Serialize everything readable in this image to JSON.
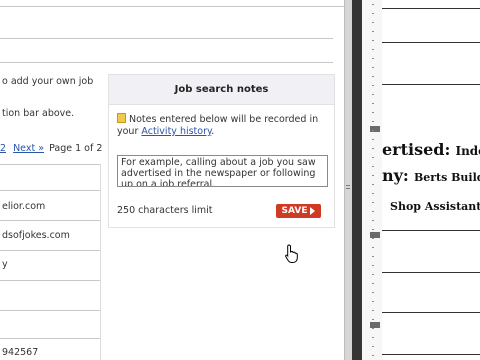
{
  "left_panel": {
    "intro_line1": "o add your own job",
    "intro_line2": "tion bar above.",
    "pager": {
      "page_link": "2",
      "next_label": "Next »",
      "page_info": "Page 1 of 2"
    },
    "rows": [
      "elior.com",
      "dsofjokes.com",
      "y",
      "942567"
    ]
  },
  "notes": {
    "title": "Job search notes",
    "info_text": "Notes entered below will be recorded in your ",
    "activity_link": "Activity history",
    "info_end": ".",
    "textarea_value": "For example, calling about a job you saw advertised in the newspaper or following up on a job referral.",
    "char_limit": "250 characters limit",
    "save_label": "SAVE"
  },
  "document": {
    "line1_label": "ertised:",
    "line1_value": "Inde",
    "line2_label": "ny:",
    "line2_value": "Berts Build",
    "line3_value": "Shop Assistant"
  }
}
